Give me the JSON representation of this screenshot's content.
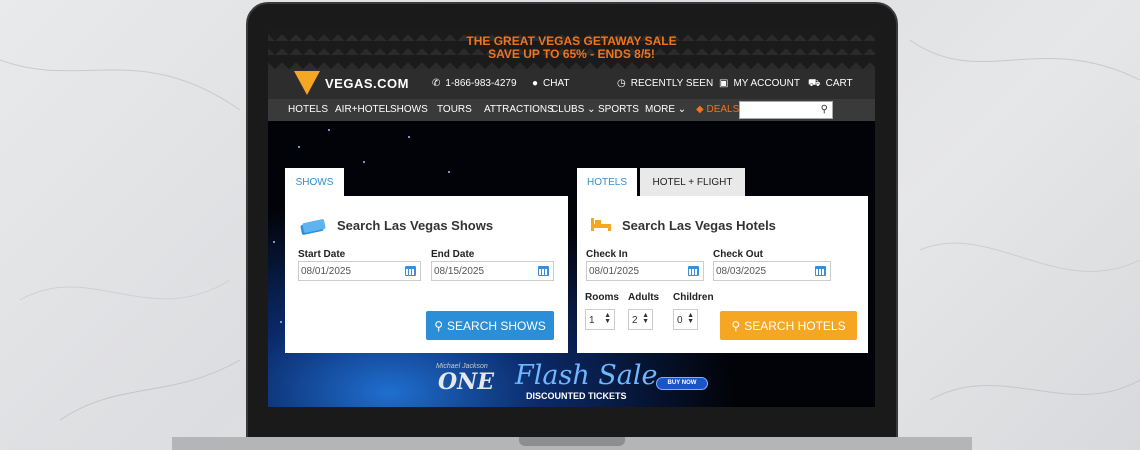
{
  "promo": {
    "line1": "THE GREAT VEGAS GETAWAY SALE",
    "line2": "SAVE UP TO 65% - ENDS 8/5!"
  },
  "header": {
    "brand": "VEGAS.COM",
    "phone": "1-866-983-4279",
    "chat": "CHAT",
    "recently_seen": "RECENTLY SEEN",
    "my_account": "MY ACCOUNT",
    "cart": "CART"
  },
  "nav": {
    "items": [
      "HOTELS",
      "AIR+HOTEL",
      "SHOWS",
      "TOURS",
      "ATTRACTIONS",
      "CLUBS",
      "SPORTS",
      "MORE",
      "DEALS"
    ],
    "search_placeholder": ""
  },
  "shows_widget": {
    "tab_label": "SHOWS",
    "title": "Search Las Vegas Shows",
    "start_label": "Start Date",
    "start_value": "08/01/2025",
    "end_label": "End Date",
    "end_value": "08/15/2025",
    "button": "SEARCH SHOWS"
  },
  "hotels_widget": {
    "tab_hotels": "HOTELS",
    "tab_hotel_flight": "HOTEL + FLIGHT",
    "title": "Search Las Vegas Hotels",
    "checkin_label": "Check In",
    "checkin_value": "08/01/2025",
    "checkout_label": "Check Out",
    "checkout_value": "08/03/2025",
    "rooms_label": "Rooms",
    "rooms_value": "1",
    "adults_label": "Adults",
    "adults_value": "2",
    "children_label": "Children",
    "children_value": "0",
    "button": "SEARCH HOTELS"
  },
  "flash_banner": {
    "show_small": "Michael Jackson",
    "show_name": "ONE",
    "title": "Flash Sale",
    "subtitle": "DISCOUNTED TICKETS",
    "cta": "BUY NOW"
  },
  "colors": {
    "accent_orange": "#f5a623",
    "promo_orange": "#f0741e",
    "accent_blue": "#2a8fd6"
  }
}
